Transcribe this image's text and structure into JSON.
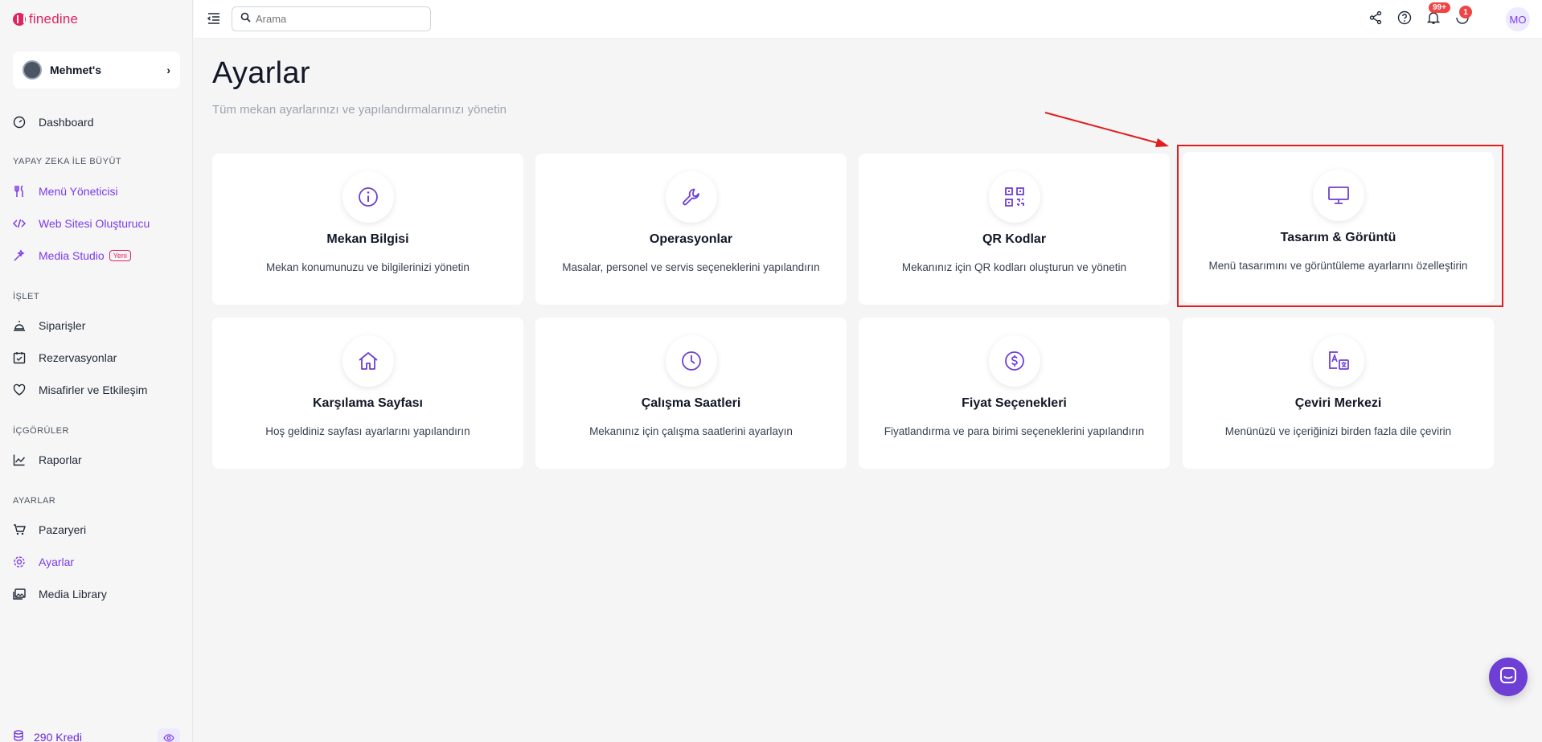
{
  "brand": {
    "name": "finedine"
  },
  "venue": {
    "name": "Mehmet's"
  },
  "sidebar": {
    "dashboard": "Dashboard",
    "section_ai": "YAPAY ZEKA İLE BÜYÜT",
    "menu_manager": "Menü Yöneticisi",
    "website_builder": "Web Sitesi Oluşturucu",
    "media_studio": "Media Studio",
    "media_studio_badge": "Yeni",
    "section_manage": "İŞLET",
    "orders": "Siparişler",
    "reservations": "Rezervasyonlar",
    "guests": "Misafirler ve Etkileşim",
    "section_insights": "İÇGÖRÜLER",
    "reports": "Raporlar",
    "section_settings": "AYARLAR",
    "marketplace": "Pazaryeri",
    "settings": "Ayarlar",
    "media_library": "Media Library",
    "credits": "290 Kredi"
  },
  "topbar": {
    "search_placeholder": "Arama",
    "notifications_count": "99+",
    "updates_count": "1",
    "user_initials": "MO"
  },
  "main": {
    "title": "Ayarlar",
    "subtitle": "Tüm mekan ayarlarınızı ve yapılandırmalarınızı yönetin",
    "cards": [
      {
        "title": "Mekan Bilgisi",
        "desc": "Mekan konumunuzu ve bilgilerinizi yönetin",
        "icon": "info-icon"
      },
      {
        "title": "Operasyonlar",
        "desc": "Masalar, personel ve servis seçeneklerini yapılandırın",
        "icon": "wrench-icon"
      },
      {
        "title": "QR Kodlar",
        "desc": "Mekanınız için QR kodları oluşturun ve yönetin",
        "icon": "qr-code-icon"
      },
      {
        "title": "Tasarım & Görüntü",
        "desc": "Menü tasarımını ve görüntüleme ayarlarını özelleştirin",
        "icon": "monitor-icon"
      },
      {
        "title": "Karşılama Sayfası",
        "desc": "Hoş geldiniz sayfası ayarlarını yapılandırın",
        "icon": "home-icon"
      },
      {
        "title": "Çalışma Saatleri",
        "desc": "Mekanınız için çalışma saatlerini ayarlayın",
        "icon": "clock-icon"
      },
      {
        "title": "Fiyat Seçenekleri",
        "desc": "Fiyatlandırma ve para birimi seçeneklerini yapılandırın",
        "icon": "dollar-icon"
      },
      {
        "title": "Çeviri Merkezi",
        "desc": "Menünüzü ve içeriğinizi birden fazla dile çevirin",
        "icon": "translate-icon"
      }
    ]
  },
  "colors": {
    "accent": "#7c3aed",
    "brand": "#e0245e",
    "highlight": "#e11d1d"
  }
}
